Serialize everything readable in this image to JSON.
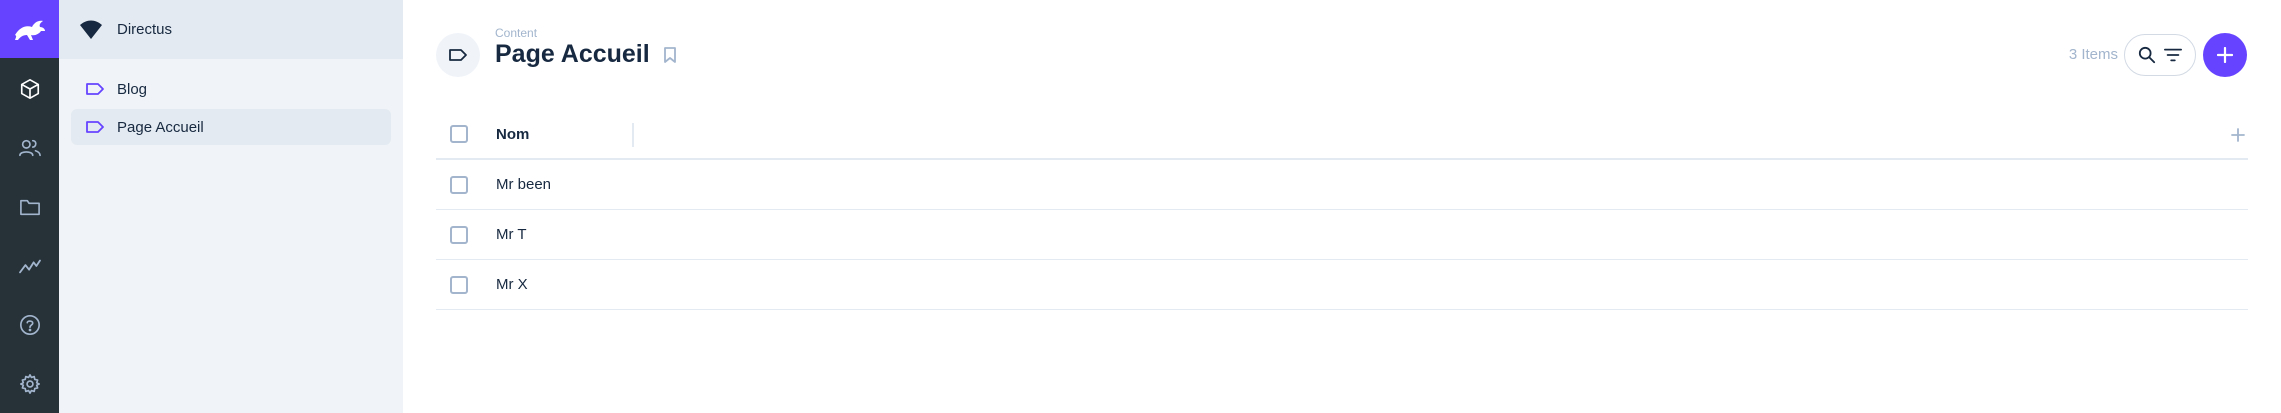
{
  "project": {
    "name": "Directus"
  },
  "rail": {
    "modules": [
      "content-icon",
      "users-icon",
      "files-icon",
      "insights-icon",
      "help-icon",
      "settings-icon"
    ]
  },
  "nav": {
    "items": [
      {
        "label": "Blog",
        "icon": "bookmark-tag-icon",
        "active": false
      },
      {
        "label": "Page Accueil",
        "icon": "bookmark-tag-icon",
        "active": true
      }
    ]
  },
  "header": {
    "breadcrumb": "Content",
    "title": "Page Accueil",
    "item_count": "3 Items"
  },
  "table": {
    "columns": [
      "Nom"
    ],
    "rows": [
      {
        "nom": "Mr been"
      },
      {
        "nom": "Mr T"
      },
      {
        "nom": "Mr X"
      }
    ]
  },
  "colors": {
    "accent": "#6644ff",
    "rail_bg": "#263238",
    "nav_bg": "#f0f4f9",
    "text": "#172940",
    "muted": "#a2b5cd"
  }
}
